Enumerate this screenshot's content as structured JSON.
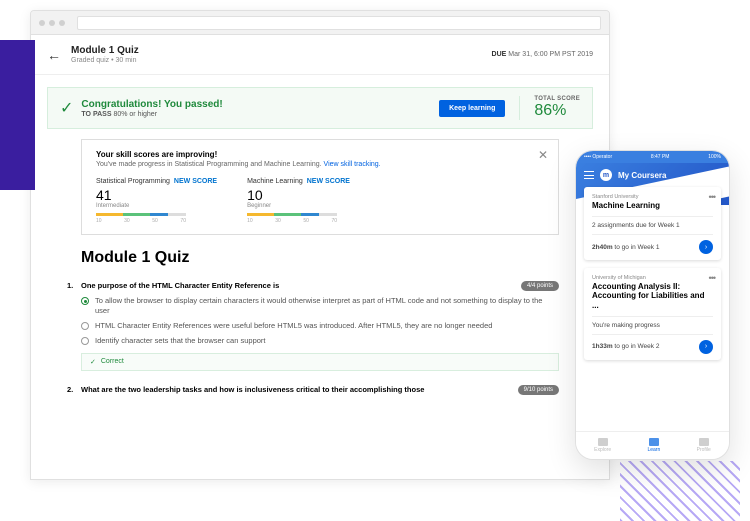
{
  "header": {
    "title": "Module 1 Quiz",
    "subtitle": "Graded quiz • 30 min",
    "due_label": "DUE",
    "due_value": "Mar 31, 6:00 PM PST 2019"
  },
  "banner": {
    "title": "Congratulations! You passed!",
    "sub_prefix": "TO PASS",
    "sub_value": "80% or higher",
    "button": "Keep learning",
    "total_label": "TOTAL SCORE",
    "total_value": "86%"
  },
  "skills": {
    "title": "Your skill scores are improving!",
    "sub": "You've made progress in Statistical Programming and Machine Learning.",
    "link": "View skill tracking.",
    "new_score_label": "NEW SCORE",
    "ticks": [
      "10",
      "30",
      "50",
      "70"
    ],
    "items": [
      {
        "name": "Statistical Programming",
        "value": "41",
        "level": "Intermediate"
      },
      {
        "name": "Machine Learning",
        "value": "10",
        "level": "Beginner"
      }
    ]
  },
  "quiz": {
    "title": "Module 1 Quiz",
    "questions": [
      {
        "num": "1.",
        "text": "One purpose of the HTML Character Entity Reference is",
        "points": "4/4 points",
        "options": [
          {
            "sel": true,
            "text": "To allow the browser to display certain characters it would otherwise interpret as part of HTML code and not something to display to the user"
          },
          {
            "sel": false,
            "text": "HTML Character Entity References were useful before HTML5 was introduced. After HTML5, they are no longer needed"
          },
          {
            "sel": false,
            "text": "Identify character sets that the browser can support"
          }
        ],
        "correct": "Correct"
      },
      {
        "num": "2.",
        "text": "What are the two leadership tasks and how is inclusiveness critical to their accomplishing those",
        "points": "9/10 points"
      }
    ]
  },
  "phone": {
    "status": {
      "left": "•••• Operator",
      "time": "8:47 PM",
      "right": "100%"
    },
    "app_title": "My Coursera",
    "cards": [
      {
        "uni": "Stanford University",
        "name": "Machine Learning",
        "line1": "2 assignments due for Week 1",
        "line2_strong": "2h40m",
        "line2_rest": " to go in Week 1"
      },
      {
        "uni": "University of Michigan",
        "name": "Accounting Analysis II: Accounting for Liabilities and ...",
        "line1": "You're making progress",
        "line2_strong": "1h33m",
        "line2_rest": " to go in Week 2"
      }
    ],
    "nav": [
      "Explore",
      "Learn",
      "Profile"
    ]
  }
}
